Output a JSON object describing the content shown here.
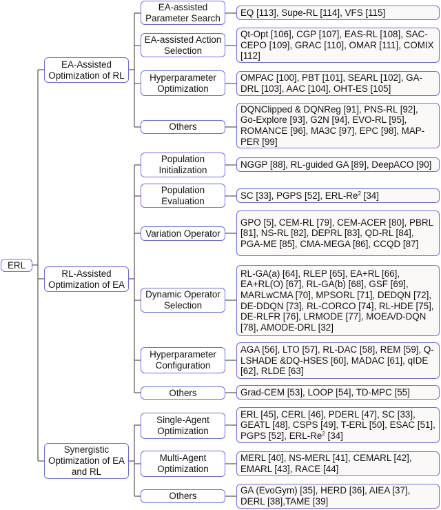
{
  "root": {
    "label": "ERL"
  },
  "branches": [
    {
      "label": "EA-Assisted Optimization of RL",
      "children": [
        {
          "label": "EA-assisted Parameter Search",
          "methods": "EQ [113], Supe-RL [114], VFS [115]"
        },
        {
          "label": "EA-assisted Action Selection",
          "methods": "Qt-Opt [106], CGP [107], EAS-RL [108], SAC-CEPO [109], GRAC [110], OMAR [111], COMIX [112]"
        },
        {
          "label": "Hyperparameter Optimization",
          "methods": "OMPAC [100], PBT [101], SEARL [102], GA-DRL [103], AAC [104], OHT-ES [105]"
        },
        {
          "label": "Others",
          "methods": "DQNClipped & DQNReg [91], PNS-RL [92], Go-Explore [93], G2N [94], EVO-RL [95], ROMANCE [96], MA3C [97], EPC [98], MAP-PER [99]"
        }
      ]
    },
    {
      "label": "RL-Assisted Optimization of EA",
      "children": [
        {
          "label": "Population Initialization",
          "methods": "NGGP [88], RL-guided GA [89], DeepACO [90]"
        },
        {
          "label": "Population Evaluation",
          "methods": "SC [33], PGPS [52], ERL-Re² [34]"
        },
        {
          "label": "Variation Operator",
          "methods": "GPO [5], CEM-RL [79], CEM-ACER [80], PBRL [81], NS-RL [82], DEPRL [83], QD-RL [84], PGA-ME [85], CMA-MEGA [86], CCQD [87]"
        },
        {
          "label": "Dynamic Operator Selection",
          "methods": "RL-GA(a) [64], RLEP [65], EA+RL [66], EA+RL(O) [67], RL-GA(b) [68], GSF [69], MARLwCMA [70], MPSORL [71], DEDQN [72], DE-DDQN [73], RL-CORCO [74], RL-HDE [75], DE-RLFR [76], LRMODE [77], MOEA/D-DQN [78], AMODE-DRL [32]"
        },
        {
          "label": "Hyperparameter Configuration",
          "methods": "AGA [56], LTO [57], RL-DAC [58], REM [59], Q-LSHADE &DQ-HSES [60], MADAC [61], qIDE [62], RLDE [63]"
        },
        {
          "label": "Others",
          "methods": "Grad-CEM [53], LOOP [54], TD-MPC [55]"
        }
      ]
    },
    {
      "label": "Synergistic Optimization of EA and RL",
      "children": [
        {
          "label": "Single-Agent Optimization",
          "methods": "ERL [45], CERL [46], PDERL [47], SC [33], GEATL [48], CSPS [49], T-ERL [50], ESAC [51], PGPS [52], ERL-Re² [34]"
        },
        {
          "label": "Multi-Agent Optimization",
          "methods": "MERL [40], NS-MERL [41], CEMARL [42], EMARL [43], RACE [44]"
        },
        {
          "label": "Others",
          "methods": "GA (EvoGym) [35], HERD [36], AIEA [37], DERL [38],TAME [39]"
        }
      ]
    }
  ]
}
